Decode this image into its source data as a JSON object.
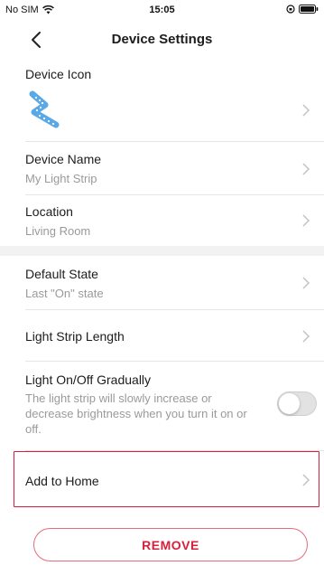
{
  "status_bar": {
    "carrier": "No SIM",
    "time": "15:05"
  },
  "nav": {
    "title": "Device Settings"
  },
  "device_icon": {
    "label": "Device Icon",
    "icon_name": "light-strip-icon"
  },
  "device_name": {
    "label": "Device Name",
    "value": "My Light Strip"
  },
  "location": {
    "label": "Location",
    "value": "Living Room"
  },
  "default_state": {
    "label": "Default State",
    "value": "Last \"On\" state"
  },
  "light_strip_length": {
    "label": "Light Strip Length"
  },
  "gradual": {
    "label": "Light On/Off Gradually",
    "description": "The light strip will slowly increase or decrease brightness when you turn it on or off.",
    "enabled": false
  },
  "add_to_home": {
    "label": "Add to Home"
  },
  "remove": {
    "label": "REMOVE"
  },
  "colors": {
    "accent_red": "#d81e3a",
    "icon_blue": "#5aa9e6",
    "secondary_text": "#9a9a9a"
  }
}
